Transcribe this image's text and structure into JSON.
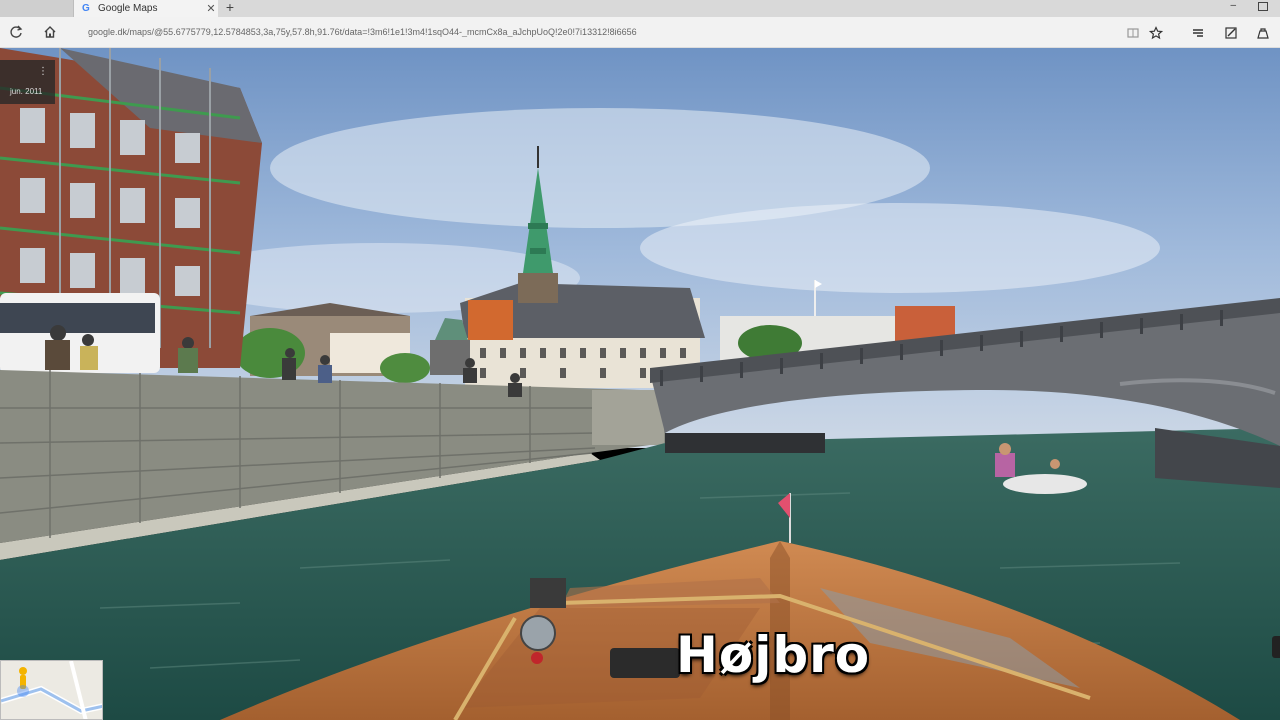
{
  "browser": {
    "tab_title": "Google Maps",
    "tab_icon": "google-g-icon",
    "url": "google.dk/maps/@55.6775779,12.5784853,3a,75y,57.8h,91.76t/data=!3m6!1e1!3m4!1sqO44-_mcmCx8a_aJchpUoQ!2e0!7i13312!8i6656"
  },
  "streetview": {
    "capture_date": "jun. 2011",
    "place_name": "Højbro"
  },
  "colors": {
    "sky_top": "#6f93c4",
    "water": "#2a5a50",
    "bridge": "#6b6e73",
    "spire": "#3f9a6c",
    "boat_wood": "#c07a44"
  }
}
